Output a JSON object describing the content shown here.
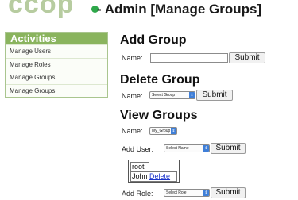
{
  "header": {
    "logo_text": "ccop",
    "title": "- Admin [Manage Groups]"
  },
  "sidebar": {
    "title": "Activities",
    "items": [
      {
        "label": "Manage Users"
      },
      {
        "label": "Manage Roles"
      },
      {
        "label": "Manage Groups"
      },
      {
        "label": "Manage Groups"
      }
    ]
  },
  "add_group": {
    "heading": "Add Group",
    "name_label": "Name:",
    "name_value": "",
    "submit_label": "Submit"
  },
  "delete_group": {
    "heading": "Delete Group",
    "name_label": "Name:",
    "select_value": "Select Group",
    "submit_label": "Submit"
  },
  "view_groups": {
    "heading": "View Groups",
    "name_label": "Name:",
    "select_value": "My_Group",
    "add_user_label": "Add User:",
    "add_user_select": "Select Name",
    "add_user_submit": "Submit",
    "users": [
      {
        "name": "root",
        "action": ""
      },
      {
        "name": "John",
        "action": "Delete"
      }
    ],
    "add_role_label": "Add Role:",
    "add_role_select": "Select Role",
    "add_role_submit": "Submit"
  },
  "colors": {
    "sidebar_header": "#8ab45e",
    "logo": "#b7cca0",
    "logo_dot": "#2ea84a",
    "select_arrow": "#3f7fd8",
    "link": "#1a33cc"
  },
  "icons": {
    "select_arrow": "up-down-arrows-icon"
  }
}
